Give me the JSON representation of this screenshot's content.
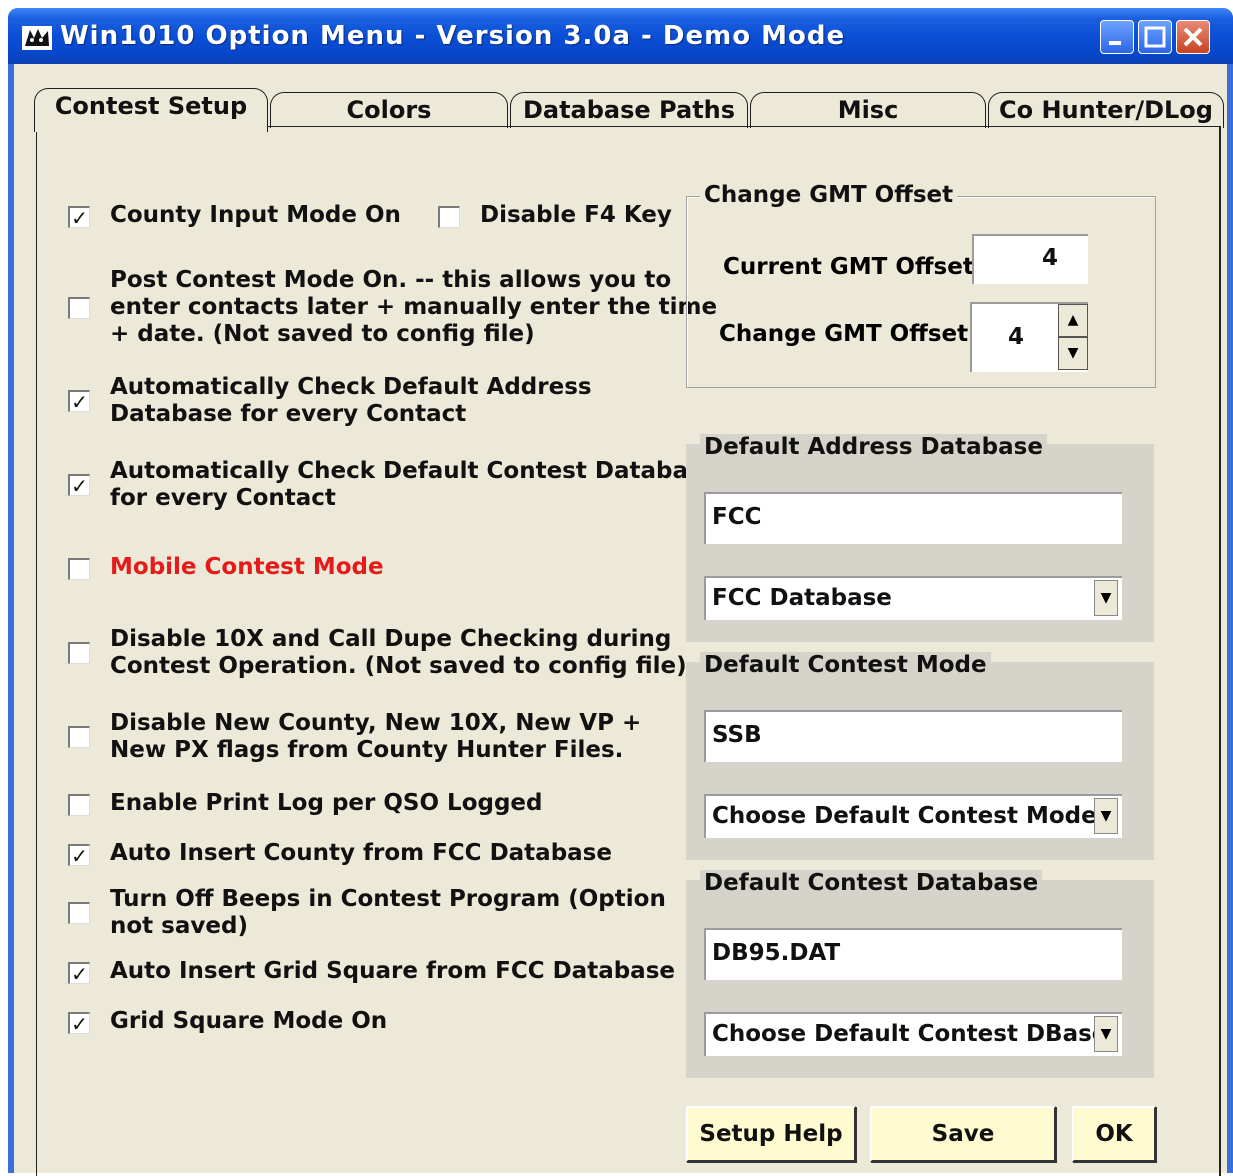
{
  "window": {
    "title": "Win1010 Option Menu - Version 3.0a  -  Demo Mode",
    "minimize_icon": "minimize-icon",
    "maximize_icon": "maximize-icon",
    "close_icon": "close-icon"
  },
  "tabs": [
    {
      "label": "Contest Setup",
      "active": true
    },
    {
      "label": "Colors"
    },
    {
      "label": "Database Paths"
    },
    {
      "label": "Misc"
    },
    {
      "label": "Co Hunter/DLog"
    }
  ],
  "options": [
    {
      "label": "County Input Mode On",
      "checked": true
    },
    {
      "label": "Disable F4 Key",
      "checked": false
    },
    {
      "label": "Post Contest Mode On. -- this allows you to\nenter contacts later + manually enter the time\n+ date. (Not saved to config file)",
      "checked": false
    },
    {
      "label": "Automatically Check Default Address\nDatabase for every Contact",
      "checked": true
    },
    {
      "label": "Automatically Check Default Contest Database\nfor every Contact",
      "checked": true
    },
    {
      "label": "Mobile Contest Mode",
      "checked": false
    },
    {
      "label": "Disable 10X and Call Dupe Checking during\nContest Operation. (Not saved to config file)",
      "checked": false
    },
    {
      "label": "Disable New County, New 10X, New VP +\nNew PX flags from County Hunter Files.",
      "checked": false
    },
    {
      "label": "Enable Print Log per QSO Logged",
      "checked": false
    },
    {
      "label": "Auto Insert County from FCC Database",
      "checked": true
    },
    {
      "label": "Turn Off Beeps in Contest Program (Option\nnot saved)",
      "checked": false
    },
    {
      "label": "Auto Insert Grid Square from FCC Database",
      "checked": true
    },
    {
      "label": "Grid Square Mode On",
      "checked": true
    }
  ],
  "gmt": {
    "group_title": "Change GMT Offset",
    "current_label": "Current GMT Offset",
    "current_value": "4",
    "change_label": "Change GMT Offset",
    "change_value": "4"
  },
  "address_db": {
    "group_title": "Default Address Database",
    "value": "FCC",
    "select_value": "FCC Database"
  },
  "contest_mode": {
    "group_title": "Default Contest Mode",
    "value": "SSB",
    "select_value": "Choose Default Contest Mode"
  },
  "contest_db": {
    "group_title": "Default Contest Database",
    "value": "DB95.DAT",
    "select_value": "Choose Default Contest DBase"
  },
  "buttons": {
    "help": "Setup Help",
    "save": "Save",
    "ok": "OK"
  },
  "colors": {
    "mobile_label": "#e31b1b",
    "button_bg": "#fffbd0",
    "panel_bg": "#ece9d8"
  }
}
